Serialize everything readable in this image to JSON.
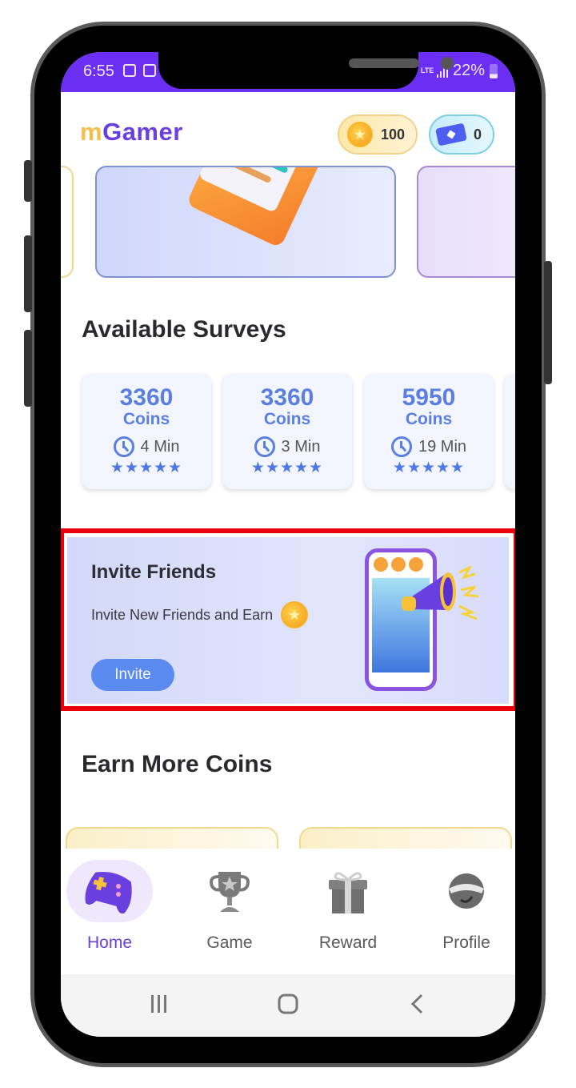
{
  "status_bar": {
    "time": "6:55",
    "network": "LTE",
    "battery": "22%",
    "icons": [
      "gallery-icon",
      "note-icon",
      "lte-icon",
      "signal-icon",
      "battery-icon"
    ]
  },
  "app_bar": {
    "logo_m": "m",
    "logo_rest": "Gamer",
    "coins": "100",
    "tickets": "0",
    "coin_icon": "star-coin-icon",
    "ticket_icon": "ticket-icon"
  },
  "colors": {
    "primary": "#6a2ff2",
    "logo_accent": "#f5c04a",
    "survey_blue": "#5a7fe0",
    "invite_button": "#5b8bef",
    "highlight_border": "#e8000b"
  },
  "surveys": {
    "title": "Available Surveys",
    "items": [
      {
        "amount": "3360",
        "unit": "Coins",
        "time": "4 Min",
        "rating": "★★★★★"
      },
      {
        "amount": "3360",
        "unit": "Coins",
        "time": "3 Min",
        "rating": "★★★★★"
      },
      {
        "amount": "5950",
        "unit": "Coins",
        "time": "19 Min",
        "rating": "★★★★★"
      }
    ]
  },
  "invite": {
    "title": "Invite Friends",
    "subtitle": "Invite New Friends and Earn",
    "button": "Invite"
  },
  "earn_more": {
    "title": "Earn More Coins"
  },
  "bottom_nav": {
    "items": [
      {
        "label": "Home",
        "icon": "gamepad-icon",
        "active": true
      },
      {
        "label": "Game",
        "icon": "trophy-icon",
        "active": false
      },
      {
        "label": "Reward",
        "icon": "gift-icon",
        "active": false
      },
      {
        "label": "Profile",
        "icon": "avatar-icon",
        "active": false
      }
    ]
  },
  "system_nav": [
    "recents-icon",
    "home-icon",
    "back-icon"
  ]
}
